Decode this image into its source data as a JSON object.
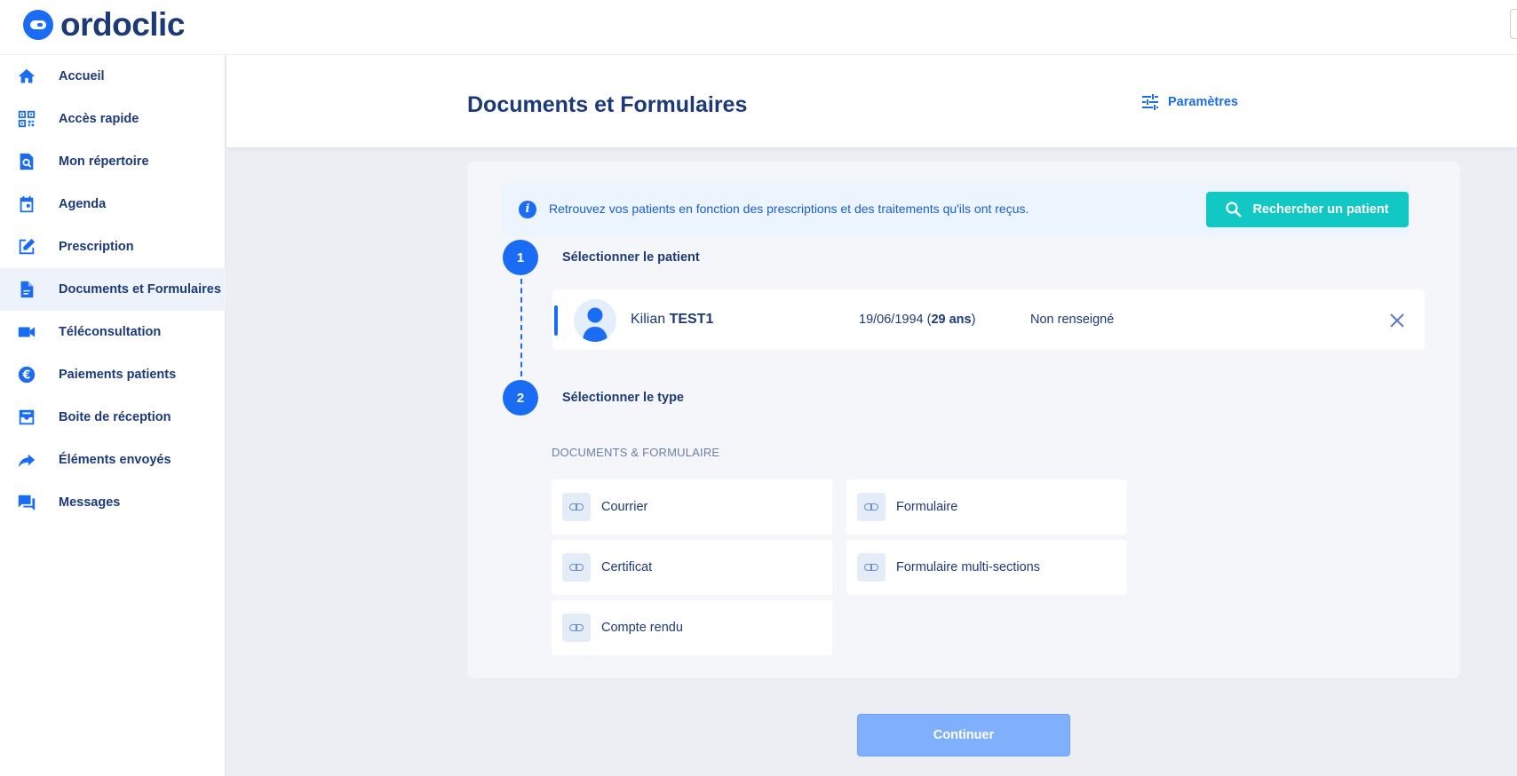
{
  "app": {
    "logo_text": "ordoclic"
  },
  "sidebar": {
    "items": [
      {
        "label": "Accueil",
        "icon": "home-icon"
      },
      {
        "label": "Accès rapide",
        "icon": "qr-code-icon"
      },
      {
        "label": "Mon répertoire",
        "icon": "directory-search-icon"
      },
      {
        "label": "Agenda",
        "icon": "calendar-icon"
      },
      {
        "label": "Prescription",
        "icon": "edit-icon"
      },
      {
        "label": "Documents et Formulaires",
        "icon": "document-icon",
        "active": true
      },
      {
        "label": "Téléconsultation",
        "icon": "video-icon"
      },
      {
        "label": "Paiements patients",
        "icon": "euro-icon"
      },
      {
        "label": "Boite de réception",
        "icon": "inbox-icon"
      },
      {
        "label": "Éléments envoyés",
        "icon": "share-arrow-icon"
      },
      {
        "label": "Messages",
        "icon": "chat-icon"
      }
    ]
  },
  "header": {
    "title": "Documents et Formulaires",
    "params_label": "Paramètres"
  },
  "info": {
    "text": "Retrouvez vos patients en fonction des prescriptions et des traitements qu'ils ont reçus.",
    "search_button": "Rechercher un patient"
  },
  "steps": [
    {
      "number": "1",
      "label": "Sélectionner le patient"
    },
    {
      "number": "2",
      "label": "Sélectionner le type"
    }
  ],
  "patient": {
    "first_name": "Kilian",
    "last_name": "TEST1",
    "dob": "19/06/1994",
    "age": "29 ans",
    "extra": "Non renseigné"
  },
  "documents": {
    "section_title": "DOCUMENTS & FORMULAIRE",
    "items": [
      {
        "label": "Courrier"
      },
      {
        "label": "Formulaire"
      },
      {
        "label": "Certificat"
      },
      {
        "label": "Formulaire multi-sections"
      },
      {
        "label": "Compte rendu"
      }
    ]
  },
  "footer": {
    "continue_label": "Continuer"
  },
  "colors": {
    "primary": "#1a6cf5",
    "navy": "#1d3a78",
    "teal": "#12c8c4",
    "disabled": "#80b0fb"
  }
}
